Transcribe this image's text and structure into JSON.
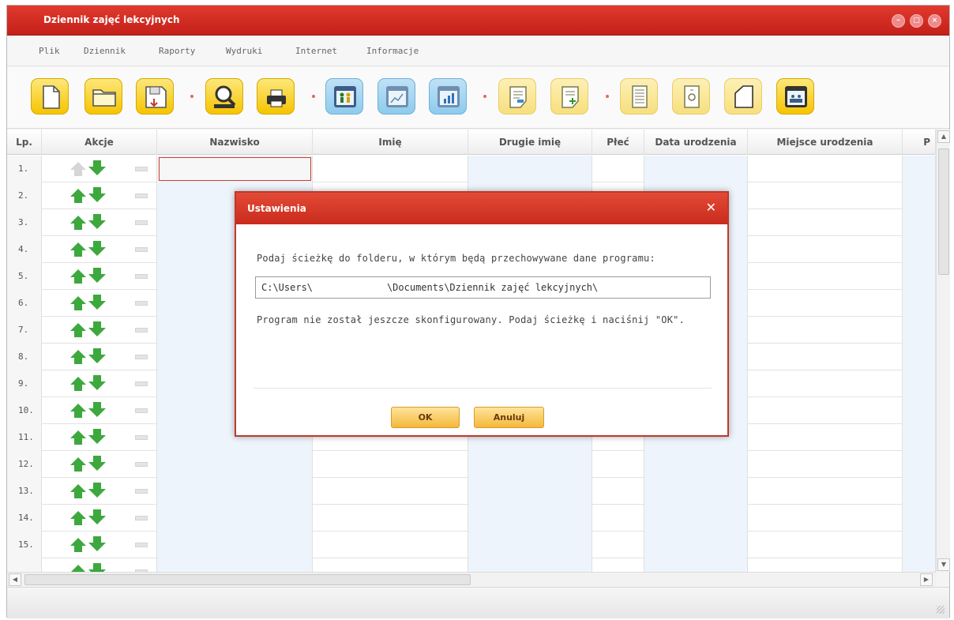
{
  "window": {
    "title": "Dziennik zajęć lekcyjnych",
    "controls": [
      "–",
      "□",
      "×"
    ]
  },
  "menu": [
    "Plik",
    "Dziennik",
    "Raporty",
    "Wydruki",
    "Internet",
    "Informacje"
  ],
  "toolbar": {
    "buttons": [
      {
        "name": "new-document-button",
        "icon": "new-document-icon",
        "style": "yellow"
      },
      {
        "name": "open-folder-button",
        "icon": "folder-icon",
        "style": "yellow"
      },
      {
        "name": "save-button",
        "icon": "save-icon",
        "style": "yellow"
      },
      {
        "name": "preview-button",
        "icon": "magnifier-icon",
        "style": "yellow"
      },
      {
        "name": "print-button",
        "icon": "printer-icon",
        "style": "yellow"
      },
      {
        "name": "students-button",
        "icon": "people-window-icon",
        "style": "blue"
      },
      {
        "name": "chart-line-button",
        "icon": "line-chart-window-icon",
        "style": "blue"
      },
      {
        "name": "chart-bar-button",
        "icon": "bar-chart-window-icon",
        "style": "blue"
      },
      {
        "name": "note-button",
        "icon": "note-icon",
        "style": "pale"
      },
      {
        "name": "note-add-button",
        "icon": "note-add-icon",
        "style": "pale"
      },
      {
        "name": "list-document-button",
        "icon": "list-document-icon",
        "style": "pale"
      },
      {
        "name": "certificate-button",
        "icon": "certificate-icon",
        "style": "pale"
      },
      {
        "name": "blank-page-button",
        "icon": "blank-page-icon",
        "style": "pale"
      },
      {
        "name": "classroom-button",
        "icon": "classroom-window-icon",
        "style": "yellow"
      }
    ]
  },
  "table": {
    "headers": [
      "Lp.",
      "Akcje",
      "Nazwisko",
      "Imię",
      "Drugie imię",
      "Płeć",
      "Data urodzenia",
      "Miejsce urodzenia",
      "P"
    ],
    "rows": [
      "1.",
      "2.",
      "3.",
      "4.",
      "5.",
      "6.",
      "7.",
      "8.",
      "9.",
      "10.",
      "11.",
      "12.",
      "13.",
      "14.",
      "15.",
      ""
    ]
  },
  "dialog": {
    "title": "Ustawienia",
    "close": "✕",
    "prompt": "Podaj ścieżkę do folderu, w którym będą przechowywane dane programu:",
    "path_value": "C:\\Users\\             \\Documents\\Dziennik zajęć lekcyjnych\\",
    "info": "Program nie został jeszcze skonfigurowany. Podaj ścieżkę i naciśnij \"OK\".",
    "ok_label": "OK",
    "cancel_label": "Anuluj"
  },
  "colors": {
    "accent_red": "#c92a1c",
    "button_yellow": "#f5c400",
    "arrow_green": "#3da83d",
    "column_blue": "#eef4fb"
  }
}
